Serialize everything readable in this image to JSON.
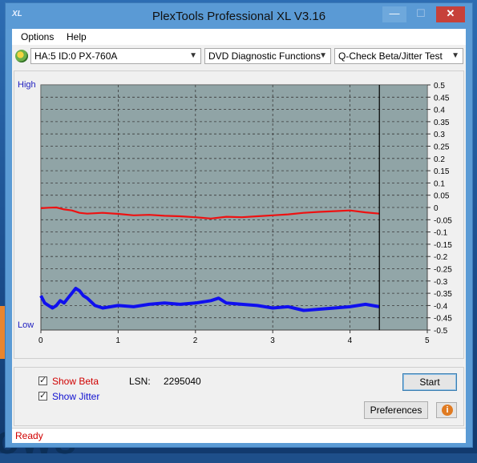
{
  "window": {
    "title": "PlexTools Professional XL V3.16",
    "app_icon": "XL",
    "colors": {
      "titlebar": "#5a9ad5",
      "close": "#c7413a"
    }
  },
  "menu": {
    "items": [
      {
        "label": "Options"
      },
      {
        "label": "Help"
      }
    ]
  },
  "toolbar": {
    "drive": "HA:5 ID:0  PX-760A",
    "function": "DVD Diagnostic Functions",
    "test": "Q-Check Beta/Jitter Test"
  },
  "chart_data": {
    "type": "line",
    "y_left_labels": {
      "high": "High",
      "low": "Low"
    },
    "x_ticks": [
      "0",
      "1",
      "2",
      "3",
      "4",
      "5"
    ],
    "xlim": [
      0,
      5
    ],
    "ylim": [
      -0.5,
      0.5
    ],
    "y_ticks": [
      "0.5",
      "0.45",
      "0.4",
      "0.35",
      "0.3",
      "0.25",
      "0.2",
      "0.15",
      "0.1",
      "0.05",
      "0",
      "-0.05",
      "-0.1",
      "-0.15",
      "-0.2",
      "-0.25",
      "-0.3",
      "-0.35",
      "-0.4",
      "-0.45",
      "-0.5"
    ],
    "grid": true,
    "end_marker_x": 4.38,
    "series": [
      {
        "color": "#ee1111",
        "x": [
          0,
          0.1,
          0.2,
          0.3,
          0.4,
          0.5,
          0.6,
          0.8,
          1.0,
          1.2,
          1.4,
          1.6,
          1.8,
          2.0,
          2.2,
          2.4,
          2.6,
          2.8,
          3.0,
          3.2,
          3.4,
          3.6,
          3.8,
          4.0,
          4.2,
          4.38
        ],
        "values": [
          -0.003,
          -0.001,
          0.0,
          -0.008,
          -0.012,
          -0.022,
          -0.025,
          -0.022,
          -0.026,
          -0.032,
          -0.03,
          -0.034,
          -0.036,
          -0.04,
          -0.045,
          -0.038,
          -0.04,
          -0.036,
          -0.032,
          -0.028,
          -0.022,
          -0.018,
          -0.015,
          -0.012,
          -0.02,
          -0.025
        ]
      },
      {
        "color": "#1010ee",
        "x": [
          0,
          0.05,
          0.1,
          0.15,
          0.2,
          0.25,
          0.3,
          0.35,
          0.4,
          0.45,
          0.5,
          0.55,
          0.6,
          0.7,
          0.8,
          1.0,
          1.2,
          1.4,
          1.6,
          1.8,
          2.0,
          2.2,
          2.3,
          2.4,
          2.6,
          2.8,
          3.0,
          3.2,
          3.4,
          3.6,
          3.8,
          4.0,
          4.2,
          4.38
        ],
        "values": [
          -0.36,
          -0.39,
          -0.4,
          -0.41,
          -0.4,
          -0.38,
          -0.39,
          -0.37,
          -0.35,
          -0.33,
          -0.34,
          -0.36,
          -0.37,
          -0.4,
          -0.41,
          -0.4,
          -0.405,
          -0.395,
          -0.39,
          -0.395,
          -0.39,
          -0.38,
          -0.37,
          -0.39,
          -0.395,
          -0.4,
          -0.41,
          -0.405,
          -0.42,
          -0.415,
          -0.41,
          -0.405,
          -0.395,
          -0.405
        ]
      }
    ]
  },
  "controls": {
    "show_beta": "Show Beta",
    "show_jitter": "Show Jitter",
    "lsn_label": "LSN:",
    "lsn_value": "2295040",
    "start": "Start",
    "preferences": "Preferences",
    "beta_color": "#d00000",
    "jitter_color": "#1010d0"
  },
  "status": "Ready",
  "desktop": {
    "word": "ows"
  }
}
